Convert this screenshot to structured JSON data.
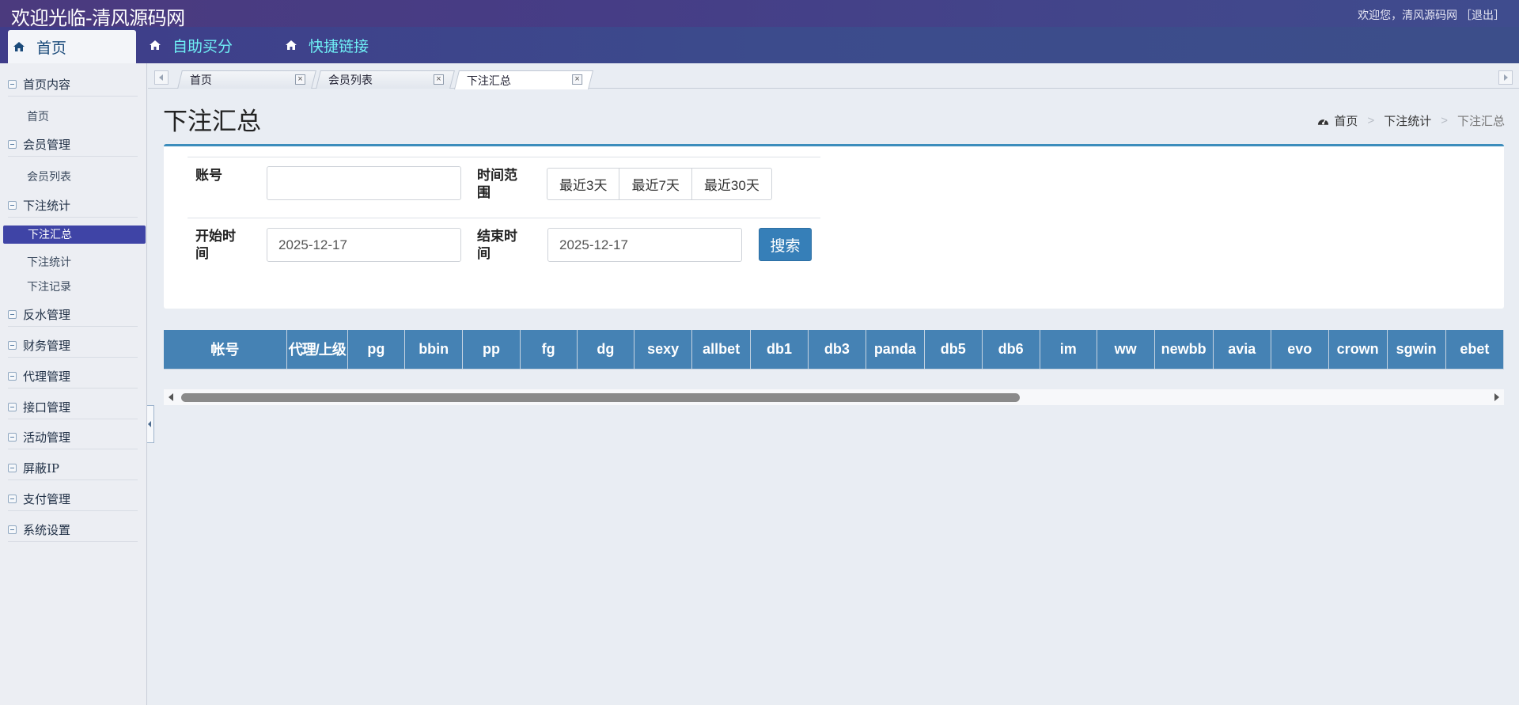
{
  "app": {
    "title": "欢迎光临-清风源码网",
    "welcome": "欢迎您，清风源码网",
    "logout": "［退出］"
  },
  "nav": [
    {
      "label": "首页"
    },
    {
      "label": "自助买分"
    },
    {
      "label": "快捷链接"
    }
  ],
  "sidebar": {
    "groups": [
      {
        "label": "首页内容",
        "items": [
          "首页"
        ]
      },
      {
        "label": "会员管理",
        "items": [
          "会员列表"
        ]
      },
      {
        "label": "下注统计",
        "items": [
          "下注汇总",
          "下注统计",
          "下注记录"
        ]
      },
      {
        "label": "反水管理",
        "items": []
      },
      {
        "label": "财务管理",
        "items": []
      },
      {
        "label": "代理管理",
        "items": []
      },
      {
        "label": "接口管理",
        "items": []
      },
      {
        "label": "活动管理",
        "items": []
      },
      {
        "label": "屏蔽IP",
        "items": []
      },
      {
        "label": "支付管理",
        "items": []
      },
      {
        "label": "系统设置",
        "items": []
      }
    ],
    "active_item": "下注汇总"
  },
  "tabs": [
    {
      "label": "首页",
      "close": "×"
    },
    {
      "label": "会员列表",
      "close": "×"
    },
    {
      "label": "下注汇总",
      "close": "×",
      "active": true
    }
  ],
  "page": {
    "title": "下注汇总",
    "breadcrumb": [
      "首页",
      "下注统计",
      "下注汇总"
    ],
    "breadcrumb_sep": ">"
  },
  "form": {
    "account_label": "账号",
    "account_value": "",
    "range_label_1": "时间范",
    "range_label_2": "围",
    "range_buttons": [
      "最近3天",
      "最近7天",
      "最近30天"
    ],
    "start_label_1": "开始时",
    "start_label_2": "间",
    "start_value": "2025-12-17",
    "end_label_1": "结束时",
    "end_label_2": "间",
    "end_value": "2025-12-17",
    "search_button": "搜索"
  },
  "table": {
    "columns": [
      "帐号",
      "代理/上级",
      "pg",
      "bbin",
      "pp",
      "fg",
      "dg",
      "sexy",
      "allbet",
      "db1",
      "db3",
      "panda",
      "db5",
      "db6",
      "im",
      "ww",
      "newbb",
      "avia",
      "evo",
      "crown",
      "sgwin",
      "ebet"
    ]
  },
  "colors": {
    "topbar": "#463d86",
    "navbar": "#3c4b8c",
    "accent": "#3c8dbc",
    "table_header": "#4582b4",
    "sidebar_active": "#3f44a6",
    "nav_text": "#6ff0f6"
  }
}
